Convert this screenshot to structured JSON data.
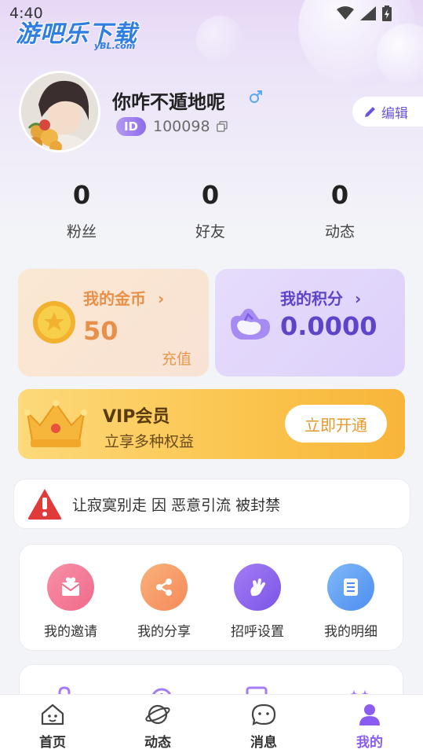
{
  "status_bar": {
    "time": "4:40"
  },
  "watermark": {
    "main": "游吧乐下载",
    "sub": "yBL.com"
  },
  "profile": {
    "name": "你咋不遁地呢",
    "id_badge": "ID",
    "id_value": "100098",
    "edit_label": "编辑"
  },
  "stats": [
    {
      "value": "0",
      "label": "粉丝"
    },
    {
      "value": "0",
      "label": "好友"
    },
    {
      "value": "0",
      "label": "动态"
    }
  ],
  "coins": {
    "title": "我的金币",
    "value": "50",
    "action": "充值",
    "color": "#e8904a"
  },
  "points": {
    "title": "我的积分",
    "value": "0.0000",
    "color": "#5f43c9"
  },
  "vip": {
    "title": "VIP会员",
    "subtitle": "立享多种权益",
    "button": "立即开通"
  },
  "notice": {
    "text": "让寂寞别走 因 恶意引流 被封禁"
  },
  "menu": [
    {
      "label": "我的邀请",
      "icon": "invite-icon",
      "color": "#f06b8a"
    },
    {
      "label": "我的分享",
      "icon": "share-icon",
      "color": "#f59a5a"
    },
    {
      "label": "招呼设置",
      "icon": "greeting-icon",
      "color": "#8b5cf0"
    },
    {
      "label": "我的明细",
      "icon": "detail-icon",
      "color": "#5a9cf5"
    }
  ],
  "tabs": [
    {
      "label": "首页",
      "icon": "home-icon"
    },
    {
      "label": "动态",
      "icon": "planet-icon"
    },
    {
      "label": "消息",
      "icon": "message-icon"
    },
    {
      "label": "我的",
      "icon": "profile-icon",
      "active": true
    }
  ]
}
